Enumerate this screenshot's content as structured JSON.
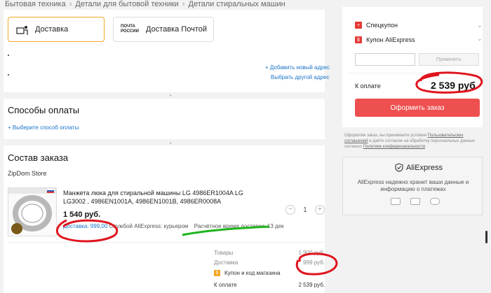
{
  "breadcrumb": [
    "Бытовая техника",
    "Детали для бытовой техники",
    "Детали стиральных машин"
  ],
  "shipping": {
    "delivery_label": "Доставка",
    "post_label": "Доставка Почтой",
    "post_logo_line1": "ПОЧТА",
    "post_logo_line2": "РОССИИ"
  },
  "address": {
    "add_new": "+ Добавить новый адрес",
    "choose_other": "Выбрать другой адрес"
  },
  "payment": {
    "title": "Способы оплаты",
    "choose": "+ Выберите способ оплаты"
  },
  "order": {
    "title": "Состав заказа",
    "store": "ZipDom Store",
    "product": {
      "title": "Манжета люка для стиральной машины LG 4986ER1004A LG LG3002 , 4986EN1001A, 4986EN1001B, 4986ER0008A",
      "price": "1 540 руб.",
      "delivery_cost": "Доставка: 999,00",
      "delivery_service": "Службой AliExpress: курьером",
      "delivery_time": "Расчётное время доставки: 13 дек",
      "quantity": "1",
      "minus": "−",
      "plus": "+"
    },
    "summary": {
      "goods_label": "Товары",
      "goods_value": "1 900 руб.",
      "delivery_label": "Доставка",
      "delivery_value": "999 руб.",
      "coupon_label": "Купон и код магазина",
      "total_label": "К оплате",
      "total_value": "2 539 руб."
    }
  },
  "sidebar": {
    "spec_coupon": "Спецкупон",
    "ae_coupon": "Купон AliExpress",
    "apply": "Применить",
    "total_label": "К оплате",
    "total_value": "2 539 руб.",
    "order_button": "Оформить заказ",
    "legal_1": "Оформляя заказ, вы принимаете условия",
    "legal_link_1": "Пользовательских соглашений",
    "legal_2": "и даёте согласие на обработку персональных данных согласно",
    "legal_link_2": "Политике конфиденциальности",
    "ali_logo": "AliExpress",
    "ali_desc": "AliExpress надежно хранит ваши данные и информацию о платежах"
  },
  "colors": {
    "accent": "#ee4f4f",
    "link": "#1a73c8",
    "active_border": "#f5a623",
    "annotation_red": "#e0141e",
    "annotation_green": "#1db51d"
  }
}
